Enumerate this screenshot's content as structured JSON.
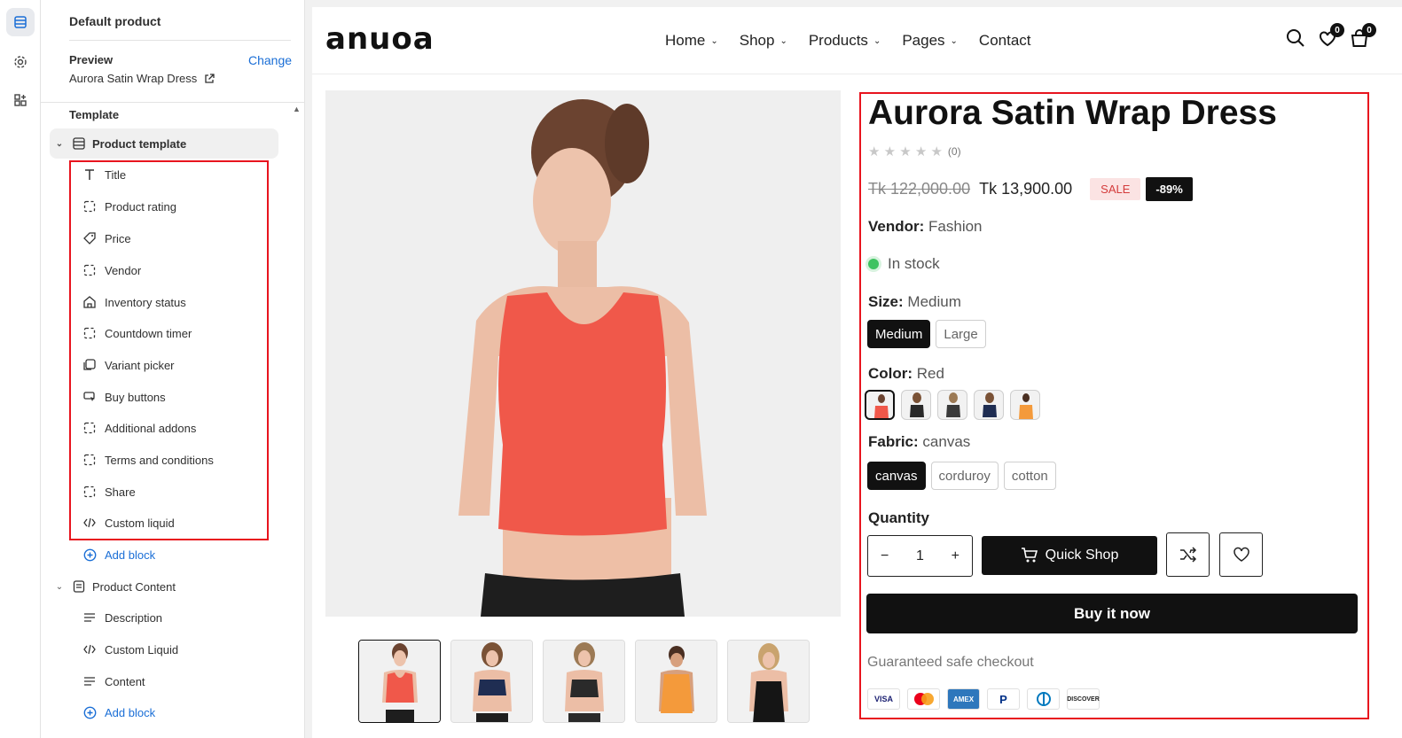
{
  "editor": {
    "title": "Default product",
    "preview_label": "Preview",
    "change_label": "Change",
    "preview_value": "Aurora Satin Wrap Dress",
    "template_label": "Template",
    "groups": [
      {
        "label": "Product template",
        "blocks": [
          "Title",
          "Product rating",
          "Price",
          "Vendor",
          "Inventory status",
          "Countdown timer",
          "Variant picker",
          "Buy buttons",
          "Additional addons",
          "Terms and conditions",
          "Share",
          "Custom liquid"
        ],
        "add_label": "Add block"
      },
      {
        "label": "Product Content",
        "blocks": [
          "Description",
          "Custom Liquid",
          "Content"
        ],
        "add_label": "Add block"
      }
    ]
  },
  "store": {
    "logo": "anuoa",
    "nav": [
      "Home",
      "Shop",
      "Products",
      "Pages",
      "Contact"
    ],
    "wishlist_count": "0",
    "cart_count": "0"
  },
  "product": {
    "title": "Aurora Satin Wrap Dress",
    "rating": 0,
    "rating_count": "(0)",
    "old_price": "Tk 122,000.00",
    "price": "Tk 13,900.00",
    "sale_badge": "SALE",
    "discount_badge": "-89%",
    "vendor_label": "Vendor:",
    "vendor": "Fashion",
    "stock": "In stock",
    "size_label": "Size:",
    "size_value": "Medium",
    "sizes": [
      "Medium",
      "Large"
    ],
    "color_label": "Color:",
    "color_value": "Red",
    "fabric_label": "Fabric:",
    "fabric_value": "canvas",
    "fabrics": [
      "canvas",
      "corduroy",
      "cotton"
    ],
    "quantity_label": "Quantity",
    "quantity": "1",
    "quick_shop": "Quick Shop",
    "buy_now": "Buy it now",
    "guarantee": "Guaranteed safe checkout",
    "payments": [
      "VISA",
      "MC",
      "AMEX",
      "PayPal",
      "Diners",
      "DISCOVER"
    ]
  },
  "colors": {
    "accent_link": "#1a6ed6",
    "highlight": "#e8141e",
    "top_red": "#f0584a",
    "in_stock": "#3fc361"
  }
}
